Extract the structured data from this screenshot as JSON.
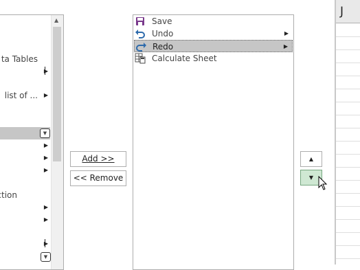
{
  "left_list": {
    "items": [
      {
        "label": "ta Tables",
        "arrow": ""
      },
      {
        "label": "",
        "arrow": "sepbar"
      },
      {
        "label": "list of ...",
        "arrow": "▶"
      },
      {
        "label": "",
        "arrow": "dd",
        "selected": true
      },
      {
        "label": "",
        "arrow": "▶"
      },
      {
        "label": "",
        "arrow": "▶"
      },
      {
        "label": "",
        "arrow": "▶"
      },
      {
        "label": "ction",
        "arrow": ""
      },
      {
        "label": "",
        "arrow": "▶"
      },
      {
        "label": "",
        "arrow": "▶"
      },
      {
        "label": "",
        "arrow": "sepbar"
      },
      {
        "label": "",
        "arrow": "dd"
      }
    ],
    "scroll_up": "▲"
  },
  "buttons": {
    "add_label": "Add >>",
    "remove_label": "<< Remove"
  },
  "right_list": {
    "items": [
      {
        "label": "Save",
        "icon": "save-icon",
        "has_submenu": false,
        "selected": false
      },
      {
        "label": "Undo",
        "icon": "undo-icon",
        "has_submenu": true,
        "selected": false
      },
      {
        "label": "Redo",
        "icon": "redo-icon",
        "has_submenu": true,
        "selected": true
      },
      {
        "label": "Calculate Sheet",
        "icon": "calculate-sheet-icon",
        "has_submenu": false,
        "selected": false
      }
    ]
  },
  "move": {
    "up_glyph": "▲",
    "down_glyph": "▼"
  },
  "grid": {
    "column_header": "J"
  }
}
